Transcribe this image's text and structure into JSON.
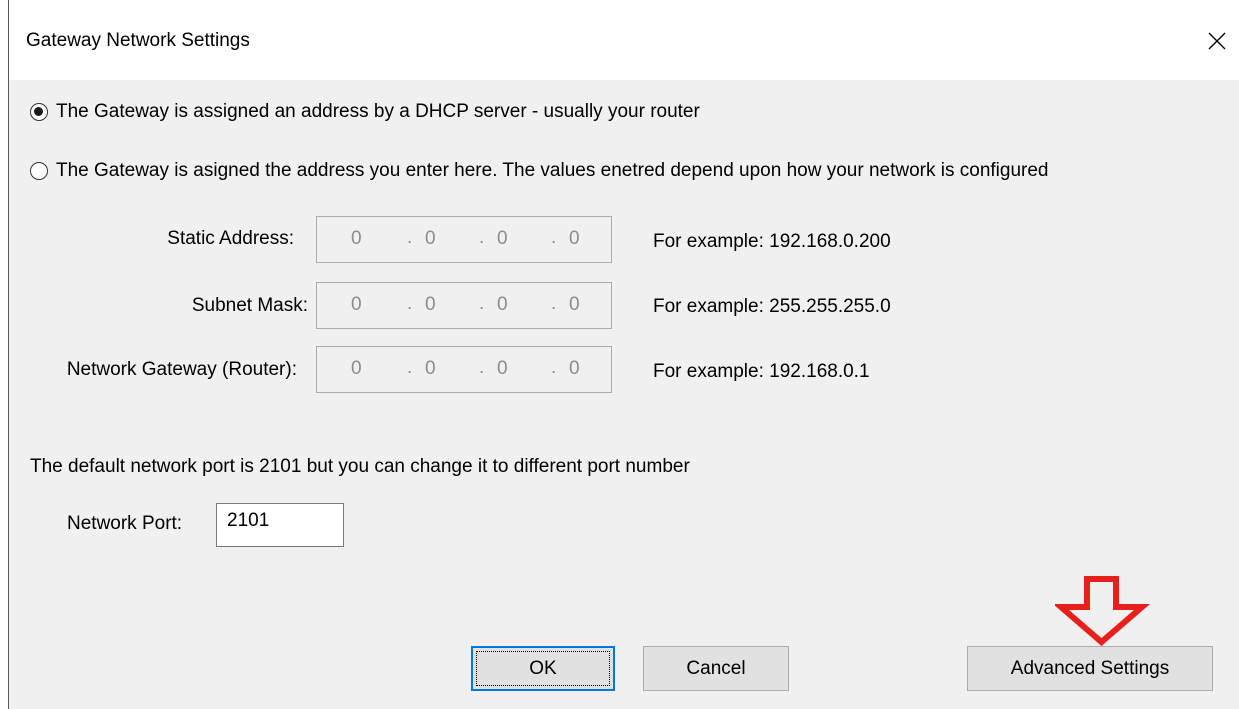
{
  "window": {
    "title": "Gateway Network Settings"
  },
  "options": {
    "dhcp_label": "The Gateway is assigned an address by a DHCP server - usually your router",
    "static_label": "The Gateway is asigned the address you enter here. The values enetred depend upon how your network is configured",
    "selected": "dhcp"
  },
  "fields": [
    {
      "label": "Static Address:",
      "octets": [
        "0",
        "0",
        "0",
        "0"
      ],
      "example": "For example: 192.168.0.200"
    },
    {
      "label": "Subnet Mask:",
      "octets": [
        "0",
        "0",
        "0",
        "0"
      ],
      "example": "For example: 255.255.255.0"
    },
    {
      "label": "Network Gateway (Router):",
      "octets": [
        "0",
        "0",
        "0",
        "0"
      ],
      "example": "For example: 192.168.0.1"
    }
  ],
  "port": {
    "info": "The default network port is 2101 but you can change it to different port number",
    "label": "Network Port:",
    "value": "2101"
  },
  "buttons": {
    "ok": "OK",
    "cancel": "Cancel",
    "advanced": "Advanced Settings"
  },
  "icons": {
    "close": "close-icon",
    "annotation_arrow": "down-arrow-annotation-icon"
  },
  "colors": {
    "dialog_bg": "#f0f0f0",
    "titlebar_bg": "#ffffff",
    "button_bg": "#e1e1e1",
    "focus_border": "#0078d7",
    "annotation_arrow": "#e8201c",
    "disabled_text": "#8c8c8c"
  }
}
